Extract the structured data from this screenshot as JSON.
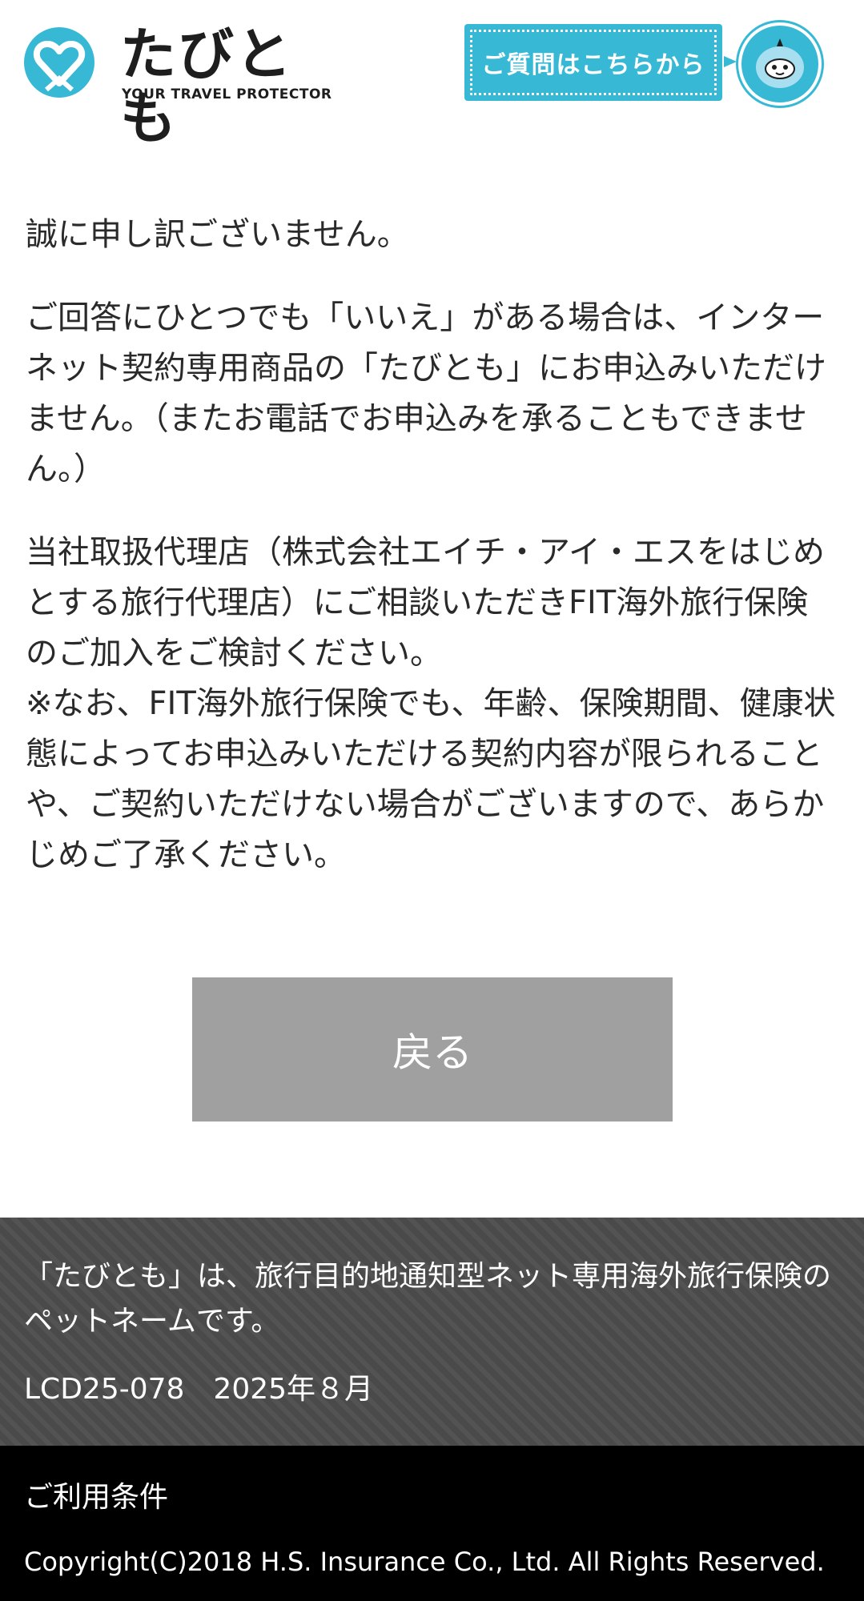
{
  "header": {
    "logo_title": "たびとも",
    "logo_subtitle": "YOUR TRAVEL PROTECTOR",
    "ask_button_label": "ご質問はこちらから",
    "brand_color": "#37b9d6"
  },
  "main": {
    "paragraph_1": "誠に申し訳ございません。",
    "paragraph_2": "ご回答にひとつでも「いいえ」がある場合は、インターネット契約専用商品の「たびとも」にお申込みいただけません。（またお電話でお申込みを承ることもできません。）",
    "paragraph_3": "当社取扱代理店（株式会社エイチ・アイ・エスをはじめとする旅行代理店）にご相談いただきFIT海外旅行保険のご加入をご検討ください。",
    "paragraph_4": "※なお、FIT海外旅行保険でも、年齢、保険期間、健康状態によってお申込みいただける契約内容が限られることや、ご契約いただけない場合がございますので、あらかじめご了承ください。",
    "back_button_label": "戻る"
  },
  "footer": {
    "pet_name_note": "「たびとも」は、旅行目的地通知型ネット専用海外旅行保険のペットネームです。",
    "document_code": "LCD25-078　2025年８月",
    "terms_link": "ご利用条件",
    "copyright": "Copyright(C)2018 H.S. Insurance Co., Ltd. All Rights Reserved."
  }
}
